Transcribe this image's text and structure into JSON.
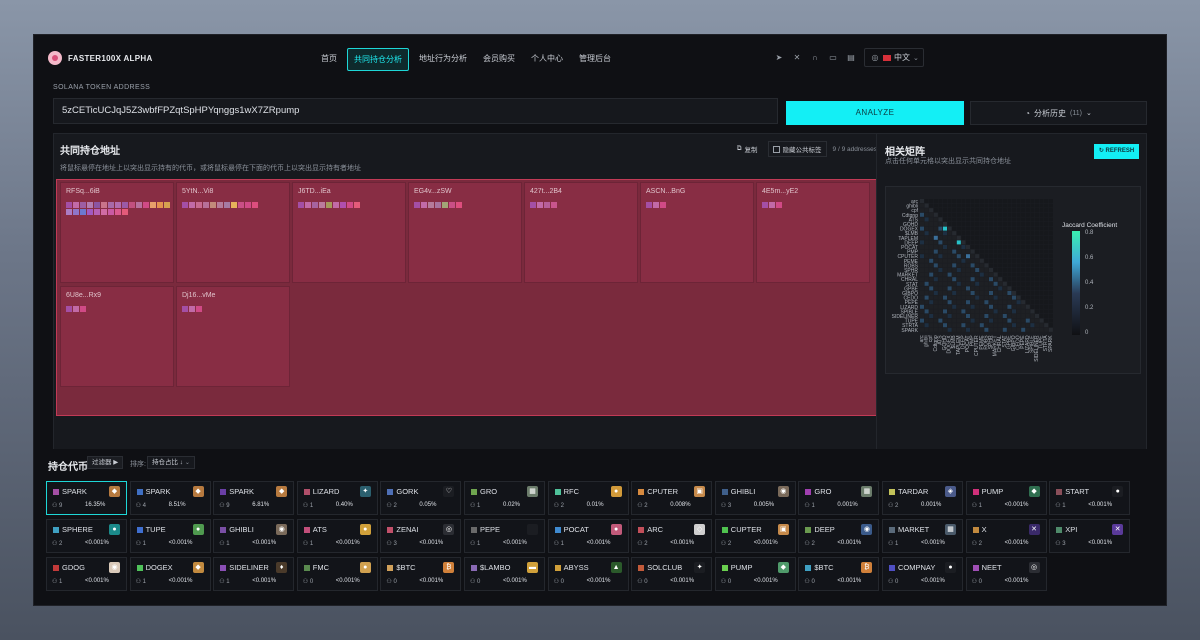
{
  "app": {
    "logo_text": "FASTER100X ALPHA"
  },
  "nav": {
    "items": [
      "首页",
      "共同持仓分析",
      "地址行为分析",
      "会员购买",
      "个人中心",
      "管理后台"
    ],
    "active_index": 1
  },
  "social_icons": [
    "telegram-icon",
    "x-icon",
    "headset-icon",
    "chat-icon",
    "document-icon"
  ],
  "lang": {
    "label": "中文"
  },
  "address": {
    "label": "SOLANA TOKEN ADDRESS",
    "value": "5zCETicUCJqJ5Z3wbfFPZqtSpHPYqnggs1wX7ZRpump"
  },
  "analyze_label": "ANALYZE",
  "history": {
    "label": "分析历史",
    "count": "(11)"
  },
  "common": {
    "title": "共同持仓地址",
    "subtitle": "将鼠标悬停在地址上以突出显示持有的代币，或将鼠标悬停在下面的代币上以突出显示持有者地址",
    "copy_label": "复制",
    "hide_label": "隐藏公共标签",
    "count_label": "9 / 9 addresses",
    "addresses": [
      {
        "name": "RFSq...6iB",
        "colors": [
          "#a44fa5",
          "#c26aa7",
          "#9d5ea4",
          "#b37cb0",
          "#8b55a2",
          "#c9748a",
          "#a86aa8",
          "#b26cae",
          "#9b5aa6",
          "#c2507f",
          "#b7719e",
          "#d04a86",
          "#e8a06b",
          "#e4934f",
          "#d6a14f",
          "#ab7cc4",
          "#8f76c8",
          "#6d79cf",
          "#a15ac1",
          "#b660b5",
          "#d06ca4",
          "#c95aa4",
          "#db5a8f",
          "#e45b7a"
        ]
      },
      {
        "name": "5YtN...Vi8",
        "colors": [
          "#a44fa5",
          "#c26aa7",
          "#c76a90",
          "#b77099",
          "#c28a7b",
          "#b57b9a",
          "#a57aa3",
          "#e6b25a",
          "#c94f86",
          "#d04a86",
          "#dd4e7e"
        ]
      },
      {
        "name": "J6TD...iEa",
        "colors": [
          "#a44fa5",
          "#c26aa7",
          "#a6639f",
          "#bb7c9d",
          "#a59a5b",
          "#c26aa7",
          "#b04fae",
          "#d04a86",
          "#e45b7a"
        ]
      },
      {
        "name": "EG4v...zSW",
        "colors": [
          "#a44fa5",
          "#c26aa7",
          "#b57b9a",
          "#a8739e",
          "#a2a476",
          "#c94f86",
          "#dd4e7e"
        ]
      },
      {
        "name": "427t...2B4",
        "colors": [
          "#a44fa5",
          "#c26aa7",
          "#b75f99",
          "#c9558d"
        ]
      },
      {
        "name": "ASCN...BnG",
        "colors": [
          "#a44fa5",
          "#c26aa7",
          "#d04a86"
        ]
      },
      {
        "name": "4E5m...yE2",
        "colors": [
          "#a44fa5",
          "#c26aa7",
          "#d04a86"
        ]
      },
      {
        "name": "6U8e...Rx9",
        "colors": [
          "#a44fa5",
          "#c26aa7",
          "#d04a86"
        ]
      },
      {
        "name": "Dj16...vMe",
        "colors": [
          "#a44fa5",
          "#c26aa7",
          "#d04a86"
        ]
      }
    ]
  },
  "matrix": {
    "title": "相关矩阵",
    "subtitle": "点击任何单元格以突出显示共同持仓地址",
    "refresh_label": "REFRESH",
    "legend_title": "Jaccard Coefficient",
    "legend_ticks": [
      "0.8",
      "0.6",
      "0.4",
      "0.2",
      "0"
    ],
    "row_labels": [
      "arc",
      "ghibli",
      "cpf",
      "Cdtgnp",
      "ATS",
      "GOHD",
      "DOGEX",
      "$LMB",
      "TAPLEM",
      "DEEP",
      "POCAT",
      "PMP",
      "CPUTER",
      "PEME",
      "ROBS",
      "SPHR",
      "MARKET",
      "CHRAL",
      "STAT",
      "GPBE",
      "GIBPO",
      "CEDO",
      "PEPE",
      "LIZARD",
      "SPIBLE",
      "SIDELINER",
      "TUPE",
      "STRTA",
      "SPARK"
    ]
  },
  "tokens": {
    "title": "持仓代币",
    "filter_label": "过滤器 ▶",
    "sort_label": "排序:",
    "sort_value": "持仓占比 ↓",
    "items": [
      {
        "name": "SPARK",
        "color": "#a44fa5",
        "count": "9",
        "pct": "16.35%",
        "icon_bg": "#b77a3f",
        "icon_char": "◆",
        "icon": "spark-token-icon"
      },
      {
        "name": "SPARK",
        "color": "#3f6fc2",
        "count": "4",
        "pct": "8.51%",
        "icon_bg": "#b77a3f",
        "icon_char": "◆",
        "icon": "spark-token-icon"
      },
      {
        "name": "SPARK",
        "color": "#6a3fa6",
        "count": "9",
        "pct": "6.81%",
        "icon_bg": "#b77a3f",
        "icon_char": "◆",
        "icon": "spark-token-icon"
      },
      {
        "name": "LIZARD",
        "color": "#b04f6a",
        "count": "1",
        "pct": "0.40%",
        "icon_bg": "#2b5f6e",
        "icon_char": "✦",
        "icon": "lizard-token-icon"
      },
      {
        "name": "GORK",
        "color": "#4e6fb5",
        "count": "2",
        "pct": "0.05%",
        "icon_bg": "#1b1d22",
        "icon_char": "♡",
        "icon": "gork-token-icon"
      },
      {
        "name": "GRO",
        "color": "#6fa54f",
        "count": "1",
        "pct": "0.02%",
        "icon_bg": "#6b7c6b",
        "icon_char": "▦",
        "icon": "gro-token-icon"
      },
      {
        "name": "RFC",
        "color": "#4fc29a",
        "count": "2",
        "pct": "0.01%",
        "icon_bg": "#d19a3a",
        "icon_char": "●",
        "icon": "rfc-token-icon"
      },
      {
        "name": "CPUTER",
        "color": "#d78a3f",
        "count": "2",
        "pct": "0.008%",
        "icon_bg": "#c68a4b",
        "icon_char": "▣",
        "icon": "cputer-token-icon"
      },
      {
        "name": "GHIBLI",
        "color": "#3f5f8a",
        "count": "3",
        "pct": "0.005%",
        "icon_bg": "#7a6a5a",
        "icon_char": "◉",
        "icon": "ghibli-token-icon"
      },
      {
        "name": "GRO",
        "color": "#a03fb0",
        "count": "1",
        "pct": "0.001%",
        "icon_bg": "#6b7c6b",
        "icon_char": "▦",
        "icon": "gro-token-icon"
      },
      {
        "name": "TARDAR",
        "color": "#c2c25a",
        "count": "2",
        "pct": "0.001%",
        "icon_bg": "#4a5a8a",
        "icon_char": "◈",
        "icon": "tardar-token-icon"
      },
      {
        "name": "PUMP",
        "color": "#d0307a",
        "count": "1",
        "pct": "<0.001%",
        "icon_bg": "#2f6e4f",
        "icon_char": "◆",
        "icon": "pump-token-icon"
      },
      {
        "name": "START",
        "color": "#8a4f5a",
        "count": "1",
        "pct": "<0.001%",
        "icon_bg": "#1b1d22",
        "icon_char": "●",
        "icon": "start-token-icon"
      },
      {
        "name": "SPHERE",
        "color": "#3fa0c2",
        "count": "2",
        "pct": "<0.001%",
        "icon_bg": "#1b8a8a",
        "icon_char": "●",
        "icon": "sphere-token-icon"
      },
      {
        "name": "TUPE",
        "color": "#3f6fd0",
        "count": "1",
        "pct": "<0.001%",
        "icon_bg": "#4f9a4f",
        "icon_char": "●",
        "icon": "tupe-token-icon"
      },
      {
        "name": "GHIBLI",
        "color": "#7a4fa5",
        "count": "1",
        "pct": "<0.001%",
        "icon_bg": "#7a6a5a",
        "icon_char": "◉",
        "icon": "ghibli-token-icon"
      },
      {
        "name": "ATS",
        "color": "#c24f7a",
        "count": "1",
        "pct": "<0.001%",
        "icon_bg": "#d0a03a",
        "icon_char": "●",
        "icon": "ats-token-icon"
      },
      {
        "name": "ZENAI",
        "color": "#c2506a",
        "count": "3",
        "pct": "<0.001%",
        "icon_bg": "#2b2d33",
        "icon_char": "◎",
        "icon": "zenai-token-icon"
      },
      {
        "name": "PEPE",
        "color": "#6a6a6a",
        "count": "1",
        "pct": "<0.001%",
        "icon_bg": "#1b1d22",
        "icon_char": "",
        "icon": "pepe-token-icon"
      },
      {
        "name": "POCAT",
        "color": "#3f8ad0",
        "count": "1",
        "pct": "<0.001%",
        "icon_bg": "#c25a7a",
        "icon_char": "●",
        "icon": "pocat-token-icon"
      },
      {
        "name": "ARC",
        "color": "#c24f5a",
        "count": "2",
        "pct": "<0.001%",
        "icon_bg": "#cfcfcf",
        "icon_char": "◇",
        "icon": "arc-token-icon"
      },
      {
        "name": "CUPTER",
        "color": "#4fc24f",
        "count": "2",
        "pct": "<0.001%",
        "icon_bg": "#c68a4b",
        "icon_char": "▣",
        "icon": "cupter-token-icon"
      },
      {
        "name": "DEEP",
        "color": "#6a9a4f",
        "count": "2",
        "pct": "<0.001%",
        "icon_bg": "#3a5a8a",
        "icon_char": "◉",
        "icon": "deep-token-icon"
      },
      {
        "name": "MARKET",
        "color": "#5a6a7a",
        "count": "1",
        "pct": "<0.001%",
        "icon_bg": "#4a5a6a",
        "icon_char": "▦",
        "icon": "market-token-icon"
      },
      {
        "name": "X",
        "color": "#c28a3f",
        "count": "2",
        "pct": "<0.001%",
        "icon_bg": "#3a2a6a",
        "icon_char": "✕",
        "icon": "x-token-icon"
      },
      {
        "name": "XPI",
        "color": "#4f8a6a",
        "count": "3",
        "pct": "<0.001%",
        "icon_bg": "#5a3a9a",
        "icon_char": "✕",
        "icon": "xpi-token-icon"
      },
      {
        "name": "GDOG",
        "color": "#c23a3a",
        "count": "1",
        "pct": "<0.001%",
        "icon_bg": "#d9c9b9",
        "icon_char": "◉",
        "icon": "gdog-token-icon"
      },
      {
        "name": "DOGEX",
        "color": "#4fc25a",
        "count": "1",
        "pct": "<0.001%",
        "icon_bg": "#c28a3f",
        "icon_char": "◆",
        "icon": "dogex-token-icon"
      },
      {
        "name": "SIDELINER",
        "color": "#8a4fb5",
        "count": "1",
        "pct": "<0.001%",
        "icon_bg": "#4a3a2a",
        "icon_char": "♦",
        "icon": "sideliner-token-icon"
      },
      {
        "name": "FMC",
        "color": "#5a8a4f",
        "count": "0",
        "pct": "<0.001%",
        "icon_bg": "#d0a04f",
        "icon_char": "●",
        "icon": "fmc-token-icon"
      },
      {
        "name": "$BTC",
        "color": "#d0a05a",
        "count": "0",
        "pct": "<0.001%",
        "icon_bg": "#d0803a",
        "icon_char": "₿",
        "icon": "btc-token-icon"
      },
      {
        "name": "$LAMBO",
        "color": "#8a6ab5",
        "count": "0",
        "pct": "<0.001%",
        "icon_bg": "#d0a03a",
        "icon_char": "▬",
        "icon": "lambo-token-icon"
      },
      {
        "name": "ABYSS",
        "color": "#d0a03a",
        "count": "0",
        "pct": "<0.001%",
        "icon_bg": "#2b5a2b",
        "icon_char": "▲",
        "icon": "abyss-token-icon"
      },
      {
        "name": "SOLCLUB",
        "color": "#c25a3a",
        "count": "0",
        "pct": "<0.001%",
        "icon_bg": "#1b1d22",
        "icon_char": "✦",
        "icon": "solclub-token-icon"
      },
      {
        "name": "PUMP",
        "color": "#6ad04f",
        "count": "0",
        "pct": "<0.001%",
        "icon_bg": "#4f9a6a",
        "icon_char": "◆",
        "icon": "pump-token-icon"
      },
      {
        "name": "$BTC",
        "color": "#3fa0c2",
        "count": "0",
        "pct": "<0.001%",
        "icon_bg": "#d0803a",
        "icon_char": "₿",
        "icon": "btc-token-icon"
      },
      {
        "name": "COMPNAY",
        "color": "#4f4fc2",
        "count": "0",
        "pct": "<0.001%",
        "icon_bg": "#1b1d22",
        "icon_char": "●",
        "icon": "compnay-token-icon"
      },
      {
        "name": "NEET",
        "color": "#a04fb5",
        "count": "0",
        "pct": "<0.001%",
        "icon_bg": "#2b2d33",
        "icon_char": "◎",
        "icon": "neet-token-icon"
      }
    ]
  }
}
